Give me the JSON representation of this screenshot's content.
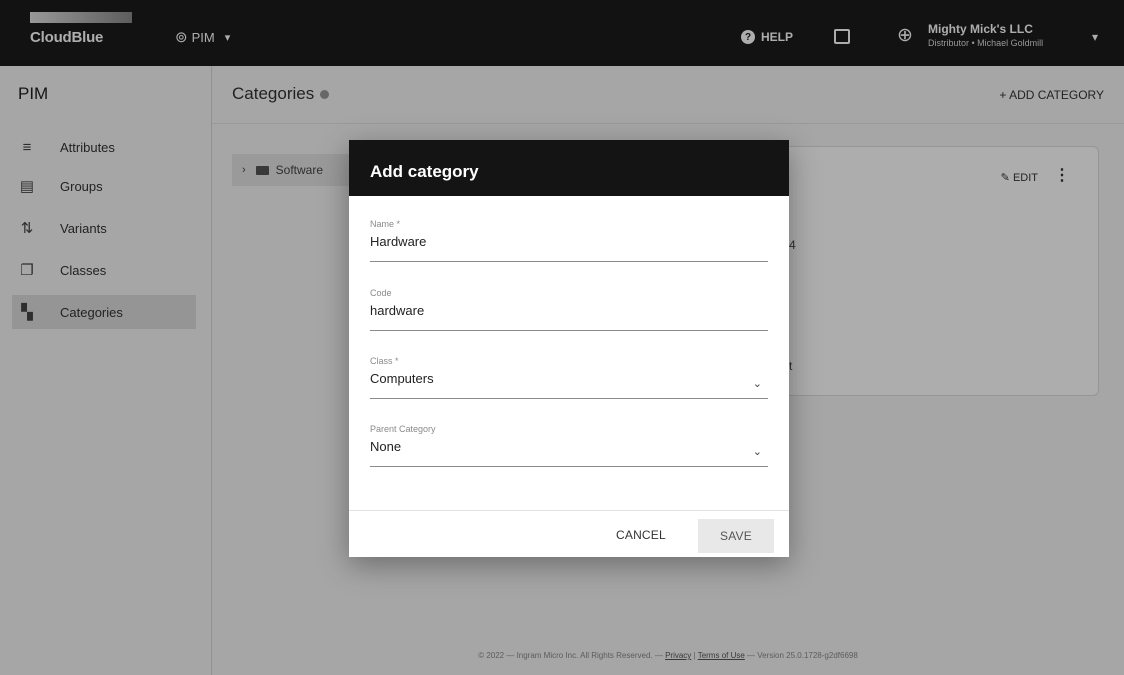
{
  "topbar": {
    "logo_text": "CloudBlue",
    "module_label": "PIM",
    "help_label": "HELP",
    "account_name": "Mighty Mick's LLC",
    "account_role": "Distributor • Michael Goldmill"
  },
  "sidebar": {
    "title": "PIM",
    "items": [
      {
        "label": "Attributes",
        "icon": "list-icon"
      },
      {
        "label": "Groups",
        "icon": "folder-icon"
      },
      {
        "label": "Variants",
        "icon": "variants-icon"
      },
      {
        "label": "Classes",
        "icon": "copy-icon"
      },
      {
        "label": "Categories",
        "icon": "tree-icon",
        "active": true
      }
    ]
  },
  "main": {
    "title": "Categories",
    "add_label": "+ ADD CATEGORY",
    "tree_item": "Software",
    "card": {
      "edit_label": "EDIT",
      "fragment_1": "4",
      "fragment_2": "t"
    },
    "footer": {
      "prefix": "© 2022 — Ingram Micro Inc. All Rights Reserved. — ",
      "privacy": "Privacy",
      "sep": " | ",
      "terms": "Terms of Use",
      "suffix": " — Version 25.0.1728-g2df6698"
    }
  },
  "dialog": {
    "title": "Add category",
    "fields": {
      "name": {
        "label": "Name *",
        "value": "Hardware"
      },
      "code": {
        "label": "Code",
        "value": "hardware"
      },
      "class": {
        "label": "Class *",
        "value": "Computers"
      },
      "parent": {
        "label": "Parent Category",
        "value": "None"
      }
    },
    "cancel_label": "CANCEL",
    "save_label": "SAVE"
  }
}
